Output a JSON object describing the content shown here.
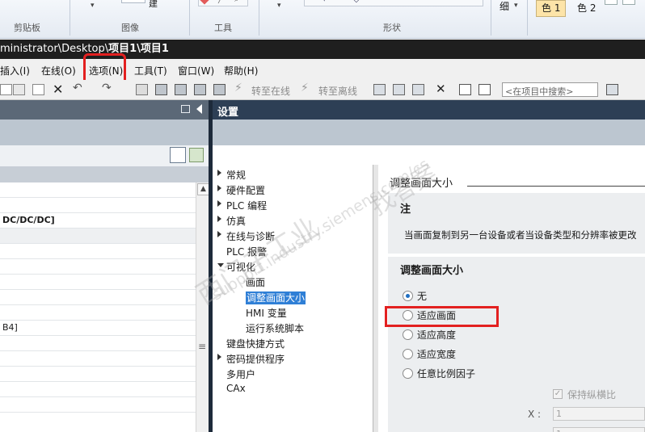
{
  "ribbon": {
    "groups": [
      "剪贴板",
      "图像",
      "工具",
      "形状"
    ],
    "partial_label": "建",
    "thickness_label": "细",
    "color1_label": "色 1",
    "color2_label": "色 2"
  },
  "titlebar": {
    "path": "ministrator\\Desktop\\",
    "project": "项目1\\项目1"
  },
  "menu": {
    "items": [
      "插入(I)",
      "在线(O)",
      "选项(N)",
      "工具(T)",
      "窗口(W)",
      "帮助(H)"
    ]
  },
  "toolbar": {
    "go_online": "转至在线",
    "go_offline": "转至离线",
    "search_placeholder": "<在项目中搜索>"
  },
  "left_pane": {
    "rows": [
      "",
      "",
      "DC/DC/DC]",
      "",
      "",
      "",
      "",
      "",
      "",
      "B4]",
      "",
      "",
      "",
      "",
      ""
    ]
  },
  "settings": {
    "title": "设置",
    "nav": [
      {
        "label": "常规",
        "level": 0,
        "arrow": "closed"
      },
      {
        "label": "硬件配置",
        "level": 0,
        "arrow": "closed"
      },
      {
        "label": "PLC 编程",
        "level": 0,
        "arrow": "closed"
      },
      {
        "label": "仿真",
        "level": 0,
        "arrow": "closed"
      },
      {
        "label": "在线与诊断",
        "level": 0,
        "arrow": "closed"
      },
      {
        "label": "PLC 报警",
        "level": 0,
        "arrow": "none"
      },
      {
        "label": "可视化",
        "level": 0,
        "arrow": "open"
      },
      {
        "label": "画面",
        "level": 1,
        "arrow": "none"
      },
      {
        "label": "调整画面大小",
        "level": 1,
        "arrow": "none",
        "selected": true
      },
      {
        "label": "HMI 变量",
        "level": 1,
        "arrow": "none"
      },
      {
        "label": "运行系统脚本",
        "level": 1,
        "arrow": "none"
      },
      {
        "label": "键盘快捷方式",
        "level": 0,
        "arrow": "none"
      },
      {
        "label": "密码提供程序",
        "level": 0,
        "arrow": "closed"
      },
      {
        "label": "多用户",
        "level": 0,
        "arrow": "none"
      },
      {
        "label": "CAx",
        "level": 0,
        "arrow": "none"
      }
    ],
    "section_title": "调整画面大小",
    "note_title": "注",
    "note_text": "当画面复制到另一台设备或者当设备类型和分辨率被更改",
    "group_title": "调整画面大小",
    "options": [
      {
        "label": "无",
        "checked": true
      },
      {
        "label": "适应画面",
        "checked": false
      },
      {
        "label": "适应高度",
        "checked": false
      },
      {
        "label": "适应宽度",
        "checked": false
      },
      {
        "label": "任意比例因子",
        "checked": false
      }
    ],
    "keep_ratio_label": "保持纵横比",
    "x_label": "X :",
    "x_value": "1",
    "y_value": "1"
  },
  "watermark": {
    "line1": "西门子工业",
    "line2": "support.industry.siemens.com/cs",
    "line3": "找答案"
  },
  "colors": {
    "highlight_box": "#e32020",
    "selected_nav": "#2f7fd6",
    "header_dark": "#2d3f55"
  }
}
